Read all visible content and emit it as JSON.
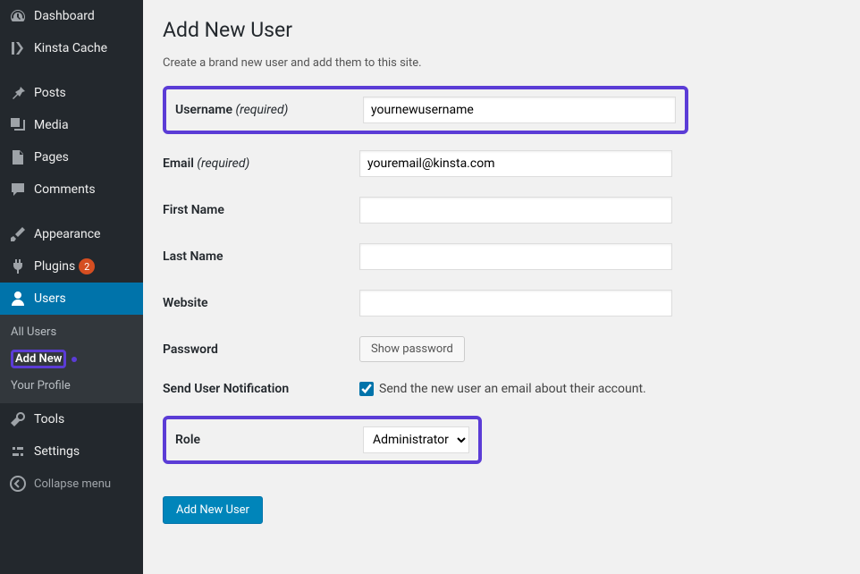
{
  "sidebar": {
    "items": [
      {
        "label": "Dashboard"
      },
      {
        "label": "Kinsta Cache"
      },
      {
        "label": "Posts"
      },
      {
        "label": "Media"
      },
      {
        "label": "Pages"
      },
      {
        "label": "Comments"
      },
      {
        "label": "Appearance"
      },
      {
        "label": "Plugins",
        "badge": "2"
      },
      {
        "label": "Users"
      },
      {
        "label": "Tools"
      },
      {
        "label": "Settings"
      }
    ],
    "subs": {
      "all": "All Users",
      "add": "Add New",
      "profile": "Your Profile"
    },
    "collapse": "Collapse menu"
  },
  "page": {
    "title": "Add New User",
    "desc": "Create a brand new user and add them to this site.",
    "labels": {
      "username": "Username",
      "email": "Email",
      "first": "First Name",
      "last": "Last Name",
      "website": "Website",
      "password": "Password",
      "notify": "Send User Notification",
      "role": "Role",
      "required": "(required)"
    },
    "values": {
      "username": "yournewusername",
      "email": "youremail@kinsta.com",
      "first": "",
      "last": "",
      "website": "",
      "role": "Administrator"
    },
    "buttons": {
      "showpw": "Show password",
      "submit": "Add New User"
    },
    "notifyText": "Send the new user an email about their account."
  }
}
